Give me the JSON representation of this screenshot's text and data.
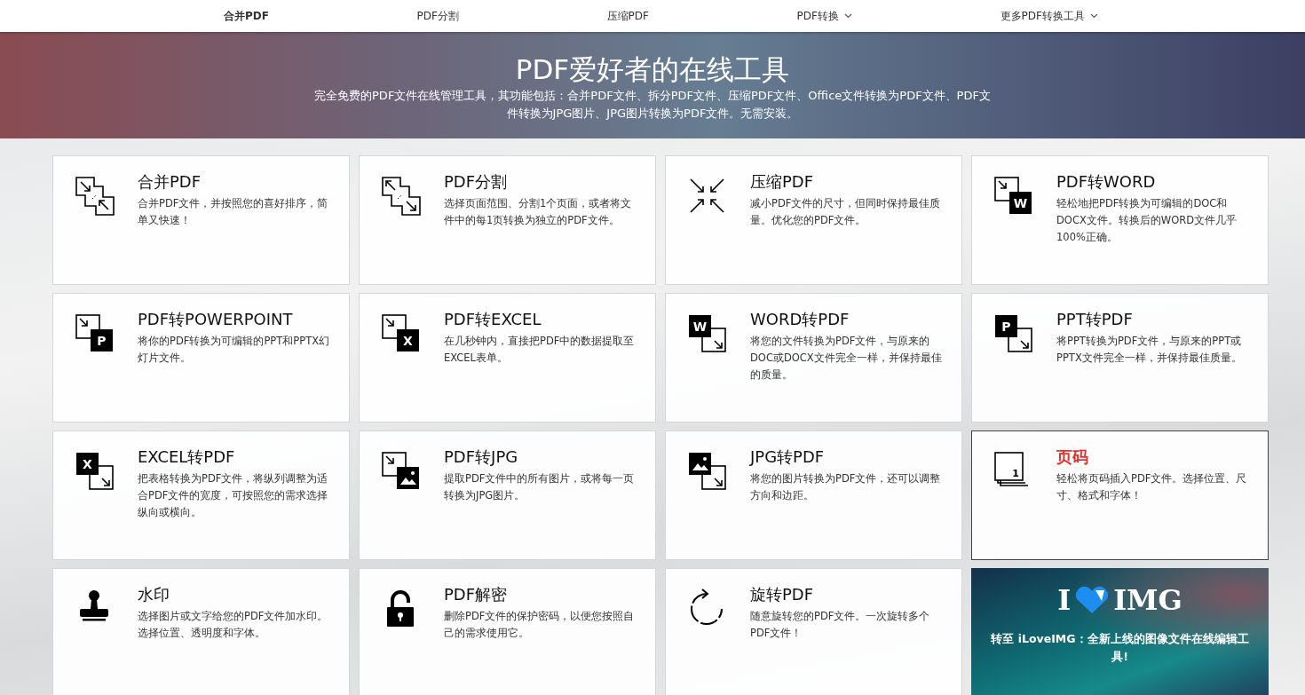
{
  "nav": [
    {
      "label": "合并PDF",
      "dropdown": false,
      "selected": true
    },
    {
      "label": "PDF分割",
      "dropdown": false,
      "selected": false
    },
    {
      "label": "压缩PDF",
      "dropdown": false,
      "selected": false
    },
    {
      "label": "PDF转换",
      "dropdown": true,
      "selected": false
    },
    {
      "label": "更多PDF转换工具",
      "dropdown": true,
      "selected": false
    }
  ],
  "hero": {
    "title": "PDF爱好者的在线工具",
    "subtitle": "完全免费的PDF文件在线管理工具，其功能包括：合并PDF文件、拆分PDF文件、压缩PDF文件、Office文件转换为PDF文件、PDF文件转换为JPG图片、JPG图片转换为PDF文件。无需安装。"
  },
  "tools": [
    {
      "kind": "merge",
      "title": "合并PDF",
      "description": "合并PDF文件，并按照您的喜好排序，简单又快速！",
      "highlighted": false
    },
    {
      "kind": "split",
      "title": "PDF分割",
      "description": "选择页面范围、分割1个页面，或者将文件中的每1页转换为独立的PDF文件。",
      "highlighted": false
    },
    {
      "kind": "compress",
      "title": "压缩PDF",
      "description": "减小PDF文件的尺寸，但同时保持最佳质量。优化您的PDF文件。",
      "highlighted": false
    },
    {
      "kind": "convert-to",
      "letter": "W",
      "title": "PDF转WORD",
      "description": "轻松地把PDF转换为可编辑的DOC和DOCX文件。转换后的WORD文件几乎100%正确。",
      "highlighted": false
    },
    {
      "kind": "convert-to",
      "letter": "P",
      "title": "PDF转POWERPOINT",
      "description": "将你的PDF转换为可编辑的PPT和PPTX幻灯片文件。",
      "highlighted": false
    },
    {
      "kind": "convert-to",
      "letter": "X",
      "title": "PDF转EXCEL",
      "description": "在几秒钟内，直接把PDF中的数据提取至EXCEL表单。",
      "highlighted": false
    },
    {
      "kind": "convert-from",
      "letter": "W",
      "title": "WORD转PDF",
      "description": "将您的文件转换为PDF文件，与原来的DOC或DOCX文件完全一样，并保持最佳的质量。",
      "highlighted": false
    },
    {
      "kind": "convert-from",
      "letter": "P",
      "title": "PPT转PDF",
      "description": "将PPT转换为PDF文件，与原来的PPT或PPTX文件完全一样，并保持最佳质量。",
      "highlighted": false
    },
    {
      "kind": "convert-from",
      "letter": "X",
      "title": "EXCEL转PDF",
      "description": "把表格转换为PDF文件，将纵列调整为适合PDF文件的宽度，可按照您的需求选择纵向或横向。",
      "highlighted": false
    },
    {
      "kind": "convert-to-image",
      "title": "PDF转JPG",
      "description": "提取PDF文件中的所有图片，或将每一页转换为JPG图片。",
      "highlighted": false
    },
    {
      "kind": "convert-from-image",
      "title": "JPG转PDF",
      "description": "将您的图片转换为PDF文件，还可以调整方向和边距。",
      "highlighted": false
    },
    {
      "kind": "page-numbers",
      "letter": "1",
      "title": "页码",
      "description": "轻松将页码插入PDF文件。选择位置、尺寸、格式和字体！",
      "highlighted": true
    },
    {
      "kind": "watermark",
      "title": "水印",
      "description": "选择图片或文字给您的PDF文件加水印。选择位置、透明度和字体。",
      "highlighted": false
    },
    {
      "kind": "unlock",
      "title": "PDF解密",
      "description": "删除PDF文件的保护密码，以便您按照自己的需求使用它。",
      "highlighted": false
    },
    {
      "kind": "rotate",
      "title": "旋转PDF",
      "description": "随意旋转您的PDF文件。一次旋转多个PDF文件！",
      "highlighted": false
    }
  ],
  "promo": {
    "logo_left": "I",
    "logo_right": "IMG",
    "caption": "转至 iLoveIMG：全新上线的图像文件在线编辑工具!"
  }
}
